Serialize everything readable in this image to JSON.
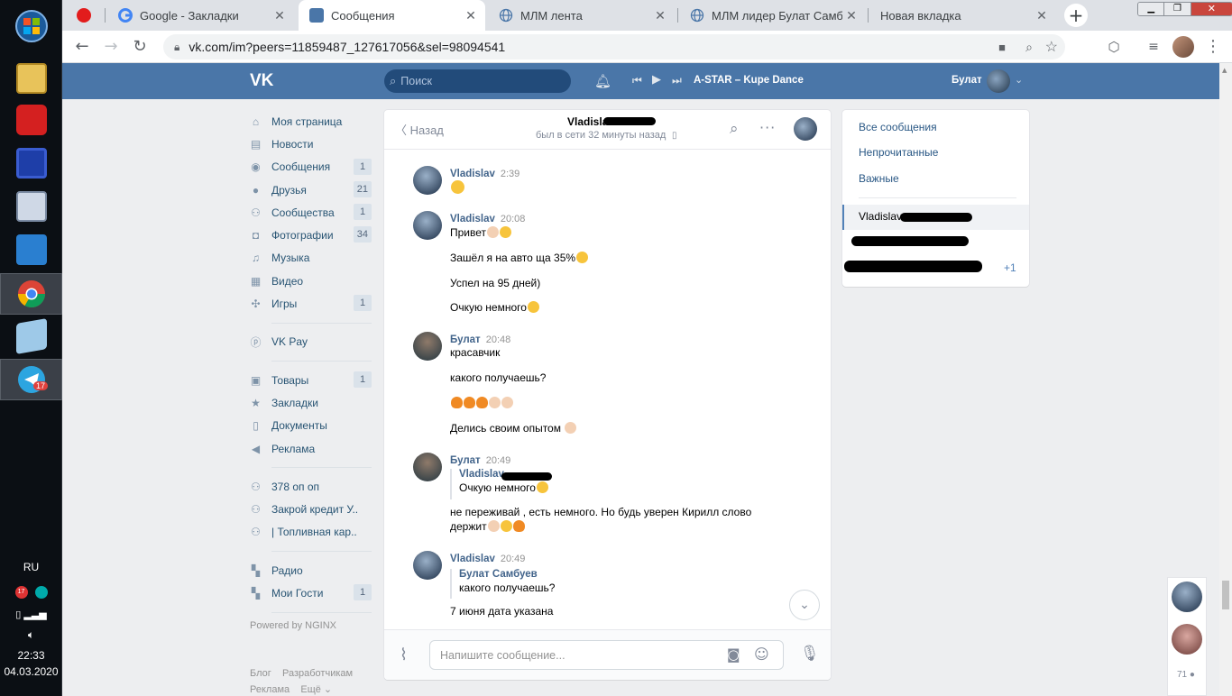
{
  "taskbar": {
    "tray_lang": "RU",
    "tray_badge": "17",
    "clock_time": "22:33",
    "clock_date": "04.03.2020",
    "telegram_badge": "17"
  },
  "browser": {
    "tabs": [
      {
        "label": ""
      },
      {
        "label": "Google - Закладки"
      },
      {
        "label": "Сообщения"
      },
      {
        "label": "МЛМ лента"
      },
      {
        "label": "МЛМ лидер Булат Самбуе"
      },
      {
        "label": "Новая вкладка"
      }
    ],
    "url": "vk.com/im?peers=11859487_127617056&sel=98094541"
  },
  "vk_header": {
    "search_placeholder": "Поиск",
    "track": "A-STAR – Kupe Dance",
    "user_name": "Булат"
  },
  "left_nav": {
    "items": [
      {
        "label": "Моя страница",
        "count": ""
      },
      {
        "label": "Новости",
        "count": ""
      },
      {
        "label": "Сообщения",
        "count": "1"
      },
      {
        "label": "Друзья",
        "count": "21"
      },
      {
        "label": "Сообщества",
        "count": "1"
      },
      {
        "label": "Фотографии",
        "count": "34"
      },
      {
        "label": "Музыка",
        "count": ""
      },
      {
        "label": "Видео",
        "count": ""
      },
      {
        "label": "Игры",
        "count": "1"
      }
    ],
    "vkpay": "VK Pay",
    "items2": [
      {
        "label": "Товары",
        "count": "1"
      },
      {
        "label": "Закладки",
        "count": ""
      },
      {
        "label": "Документы",
        "count": ""
      },
      {
        "label": "Реклама",
        "count": ""
      }
    ],
    "groups": [
      {
        "label": "378 оп оп",
        "count": ""
      },
      {
        "label": "Закрой кредит У..",
        "count": ""
      },
      {
        "label": "| Топливная кар..",
        "count": ""
      }
    ],
    "apps": [
      {
        "label": "Радио",
        "count": ""
      },
      {
        "label": "Мои Гости",
        "count": "1"
      }
    ],
    "powered": "Powered by NGINX",
    "footer_blog": "Блог",
    "footer_dev": "Разработчикам",
    "footer_ads": "Реклама",
    "footer_more": "Ещё"
  },
  "chat": {
    "back_label": "Назад",
    "peer_name": "Vladisla",
    "peer_status": "был в сети 32 минуты назад",
    "messages": [
      {
        "author": "Vladislav",
        "time": "2:39",
        "lines": [
          ""
        ]
      },
      {
        "author": "Vladislav",
        "time": "20:08",
        "lines": [
          "Привет",
          "Зашёл я на авто ща 35%",
          "Успел на 95 дней)",
          "Очкую немного"
        ]
      },
      {
        "author": "Булат",
        "time": "20:48",
        "lines": [
          "красавчик",
          "какого получаешь?",
          "",
          "Делись своим опытом"
        ]
      },
      {
        "author": "Булат",
        "time": "20:49",
        "quote_author": "Vladislav",
        "quote_text": "Очкую немного",
        "lines": [
          "не переживай , есть немного. Но будь уверен Кирилл слово",
          "держит"
        ]
      },
      {
        "author": "Vladislav",
        "time": "20:49",
        "quote_author": "Булат Самбуев",
        "quote_text": "какого получаешь?",
        "lines": [
          "7 июня дата указана"
        ]
      }
    ],
    "composer_placeholder": "Напишите сообщение..."
  },
  "right_col": {
    "filters": [
      "Все сообщения",
      "Непрочитанные",
      "Важные"
    ],
    "dialogs": [
      {
        "name": "Vladislav",
        "count": ""
      },
      {
        "name": "",
        "count": ""
      },
      {
        "name": "",
        "count": "+1"
      }
    ]
  },
  "online_bar": {
    "count": "71"
  },
  "colors": {
    "vk_blue": "#4a76a8",
    "link": "#2a5885",
    "bg": "#edeef0"
  }
}
